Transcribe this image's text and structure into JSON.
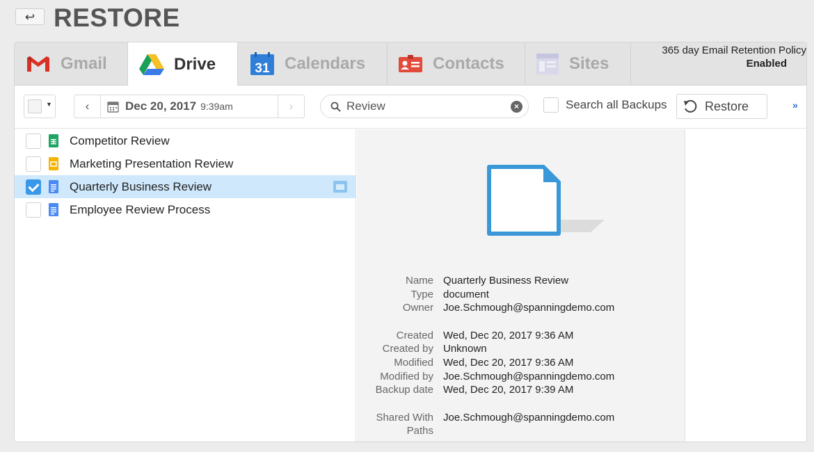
{
  "header": {
    "back_label": "↩",
    "title": "RESTORE"
  },
  "tabs": [
    {
      "label": "Gmail",
      "icon": "gmail-icon",
      "active": false
    },
    {
      "label": "Drive",
      "icon": "drive-icon",
      "active": true
    },
    {
      "label": "Calendars",
      "icon": "calendar-icon",
      "icon_text": "31",
      "active": false
    },
    {
      "label": "Contacts",
      "icon": "contacts-icon",
      "active": false
    },
    {
      "label": "Sites",
      "icon": "sites-icon",
      "active": false
    }
  ],
  "retention": {
    "text": "365 day Email Retention Policy",
    "status": "Enabled"
  },
  "toolbar": {
    "prev": "‹",
    "next": "›",
    "date": "Dec 20, 2017",
    "time": "9:39am",
    "search_value": "Review",
    "search_clear": "×",
    "search_all_label": "Search all Backups",
    "restore_label": "Restore",
    "more_label": "»"
  },
  "files": [
    {
      "name": "Competitor Review",
      "icon": "sheets-icon",
      "checked": false,
      "selected": false
    },
    {
      "name": "Marketing Presentation Review",
      "icon": "slides-icon",
      "checked": false,
      "selected": false
    },
    {
      "name": "Quarterly Business Review",
      "icon": "docs-icon",
      "checked": true,
      "selected": true
    },
    {
      "name": "Employee Review Process",
      "icon": "docs-icon",
      "checked": false,
      "selected": false
    }
  ],
  "details": {
    "name_label": "Name",
    "name": "Quarterly Business Review",
    "type_label": "Type",
    "type": "document",
    "owner_label": "Owner",
    "owner": "Joe.Schmough@spanningdemo.com",
    "created_label": "Created",
    "created": "Wed, Dec 20, 2017 9:36 AM",
    "created_by_label": "Created by",
    "created_by": "Unknown",
    "modified_label": "Modified",
    "modified": "Wed, Dec 20, 2017 9:36 AM",
    "modified_by_label": "Modified by",
    "modified_by": "Joe.Schmough@spanningdemo.com",
    "backup_date_label": "Backup date",
    "backup_date": "Wed, Dec 20, 2017 9:39 AM",
    "shared_with_label": "Shared With",
    "shared_with": "Joe.Schmough@spanningdemo.com",
    "paths_label": "Paths",
    "paths": ""
  },
  "colors": {
    "accent": "#3a98e8",
    "selected_row": "#cfe8fb",
    "gmail_red": "#d93025",
    "contacts_red": "#e24b3b"
  }
}
